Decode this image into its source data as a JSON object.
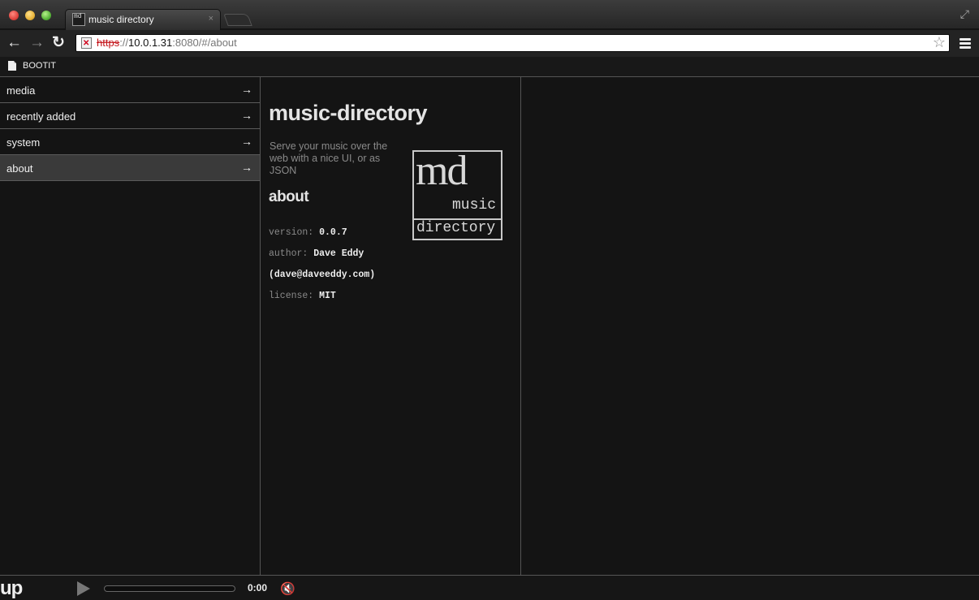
{
  "browser": {
    "tab_title": "music directory",
    "tab_favicon_text": "md",
    "tab_close": "×",
    "url": {
      "scheme": "https",
      "sep": "://",
      "host": "10.0.1.31",
      "rest": ":8080/#/about"
    },
    "bookmark": "BOOTIT",
    "icons": {
      "back": "←",
      "forward": "→",
      "reload": "↻",
      "star": "☆",
      "fullscreen": "⤢"
    }
  },
  "sidebar": {
    "items": [
      {
        "label": "media",
        "arrow": "→"
      },
      {
        "label": "recently added",
        "arrow": "→"
      },
      {
        "label": "system",
        "arrow": "→"
      },
      {
        "label": "about",
        "arrow": "→",
        "active": true
      }
    ]
  },
  "about": {
    "title": "music-directory",
    "tagline": "Serve your music over the web with a nice UI, or as JSON",
    "logo": {
      "md": "md",
      "music": "music",
      "directory": "directory"
    },
    "heading": "about",
    "version_key": "version:",
    "version": "0.0.7",
    "author_key": "author:",
    "author": "Dave Eddy",
    "email": "(dave@daveeddy.com)",
    "license_key": "license:",
    "license": "MIT"
  },
  "player": {
    "logo": "up",
    "time": "0:00",
    "progress": 0,
    "icons": {
      "play": "play-icon",
      "mute": "mute-icon"
    }
  }
}
